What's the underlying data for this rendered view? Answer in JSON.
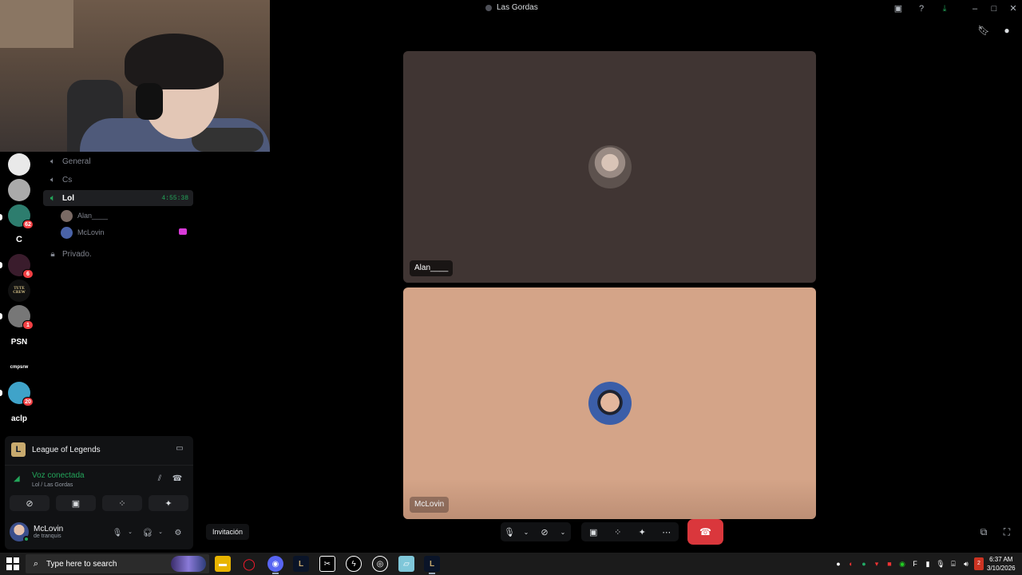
{
  "window": {
    "title": "Las Gordas"
  },
  "channels": [
    {
      "name": "General"
    },
    {
      "name": "Cs"
    },
    {
      "name": "Lol",
      "timer": "4:55:38"
    },
    {
      "name": "Privado."
    }
  ],
  "voice_members": [
    "Alan____",
    "McLovin"
  ],
  "servers": [
    {
      "label": "",
      "badge": ""
    },
    {
      "label": "",
      "badge": ""
    },
    {
      "label": "",
      "badge": "62"
    },
    {
      "label": "C",
      "badge": ""
    },
    {
      "label": "",
      "badge": "6"
    },
    {
      "label": "TUTE CREW",
      "badge": ""
    },
    {
      "label": "",
      "badge": "1"
    },
    {
      "label": "PSN",
      "badge": ""
    },
    {
      "label": "cmpsrw",
      "badge": ""
    },
    {
      "label": "",
      "badge": "20"
    },
    {
      "label": "aclp",
      "badge": ""
    }
  ],
  "voice_panel": {
    "game": "League of Legends",
    "status": "Voz conectada",
    "location": "Lol / Las Gordas"
  },
  "user": {
    "name": "McLovin",
    "status": "de tranquis"
  },
  "invite_label": "Invitación",
  "tiles": [
    {
      "name": "Alan____"
    },
    {
      "name": "McLovin"
    }
  ],
  "taskbar": {
    "search_placeholder": "Type here to search",
    "time": "6:37 AM",
    "date": "3/10/2026"
  },
  "colors": {
    "accent_green": "#23a55a",
    "hangup_red": "#da373c",
    "tile1_bg": "#403533",
    "tile2_bg": "#d4a488"
  }
}
